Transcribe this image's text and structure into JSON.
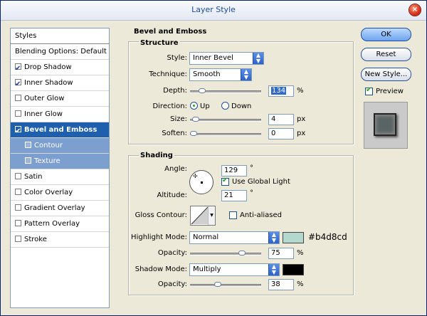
{
  "window": {
    "title": "Layer Style",
    "close_glyph": "×"
  },
  "sidebar": {
    "header": "Styles",
    "items": [
      {
        "label": "Blending Options: Default",
        "checkbox": false,
        "checked": false,
        "state": "normal"
      },
      {
        "label": "Drop Shadow",
        "checkbox": true,
        "checked": true,
        "state": "normal"
      },
      {
        "label": "Inner Shadow",
        "checkbox": true,
        "checked": true,
        "state": "normal"
      },
      {
        "label": "Outer Glow",
        "checkbox": true,
        "checked": false,
        "state": "normal"
      },
      {
        "label": "Inner Glow",
        "checkbox": true,
        "checked": false,
        "state": "normal"
      },
      {
        "label": "Bevel and Emboss",
        "checkbox": true,
        "checked": true,
        "state": "selected"
      },
      {
        "label": "Contour",
        "checkbox": true,
        "checked": false,
        "state": "sub"
      },
      {
        "label": "Texture",
        "checkbox": true,
        "checked": false,
        "state": "sub"
      },
      {
        "label": "Satin",
        "checkbox": true,
        "checked": false,
        "state": "normal"
      },
      {
        "label": "Color Overlay",
        "checkbox": true,
        "checked": false,
        "state": "normal"
      },
      {
        "label": "Gradient Overlay",
        "checkbox": true,
        "checked": false,
        "state": "normal"
      },
      {
        "label": "Pattern Overlay",
        "checkbox": true,
        "checked": false,
        "state": "normal"
      },
      {
        "label": "Stroke",
        "checkbox": true,
        "checked": false,
        "state": "normal"
      }
    ]
  },
  "bevel": {
    "title": "Bevel and Emboss",
    "structure": {
      "title": "Structure",
      "style_label": "Style:",
      "style_value": "Inner Bevel",
      "technique_label": "Technique:",
      "technique_value": "Smooth",
      "depth_label": "Depth:",
      "depth_value": "134",
      "depth_unit": "%",
      "depth_fraction": 0.13,
      "direction_label": "Direction:",
      "direction_up": "Up",
      "direction_down": "Down",
      "direction_selected": "Up",
      "size_label": "Size:",
      "size_value": "4",
      "size_unit": "px",
      "size_fraction": 0.03,
      "soften_label": "Soften:",
      "soften_value": "0",
      "soften_unit": "px",
      "soften_fraction": 0.0
    },
    "shading": {
      "title": "Shading",
      "angle_label": "Angle:",
      "angle_value": "129",
      "angle_unit": "°",
      "global_light_label": "Use Global Light",
      "global_light_checked": true,
      "altitude_label": "Altitude:",
      "altitude_value": "21",
      "altitude_unit": "°",
      "gloss_label": "Gloss Contour:",
      "antialiased_label": "Anti-aliased",
      "antialiased_checked": false,
      "highlight_label": "Highlight Mode:",
      "highlight_value": "Normal",
      "highlight_color": "#b4d8cd",
      "highlight_color_label": "#b4d8cd",
      "hopacity_label": "Opacity:",
      "hopacity_value": "75",
      "hopacity_unit": "%",
      "hopacity_fraction": 0.75,
      "shadow_label": "Shadow Mode:",
      "shadow_value": "Multiply",
      "shadow_color": "#000000",
      "sopacity_label": "Opacity:",
      "sopacity_value": "38",
      "sopacity_unit": "%",
      "sopacity_fraction": 0.38
    }
  },
  "buttons": {
    "ok": "OK",
    "reset": "Reset",
    "new_style": "New Style...",
    "preview_label": "Preview",
    "preview_checked": true
  }
}
